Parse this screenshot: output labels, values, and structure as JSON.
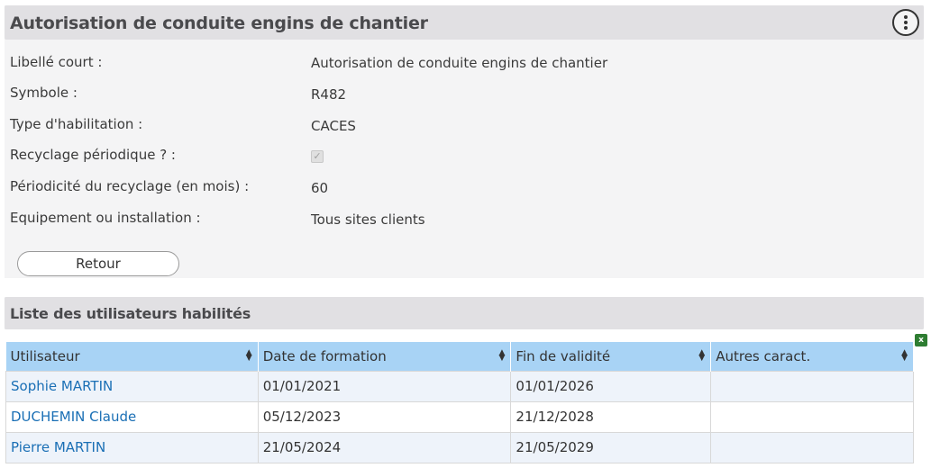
{
  "details": {
    "title": "Autorisation de conduite engins de chantier",
    "fields": [
      {
        "label": "Libellé court :",
        "value": "Autorisation de conduite engins de chantier"
      },
      {
        "label": "Symbole :",
        "value": "R482"
      },
      {
        "label": "Type d'habilitation :",
        "value": "CACES"
      },
      {
        "label": "Recyclage périodique ? :",
        "value": true
      },
      {
        "label": "Périodicité du recyclage (en mois) :",
        "value": "60"
      },
      {
        "label": "Equipement ou installation :",
        "value": "Tous sites clients"
      }
    ],
    "back_button": "Retour"
  },
  "users": {
    "title": "Liste des utilisateurs habilités",
    "columns": [
      "Utilisateur",
      "Date de formation",
      "Fin de validité",
      "Autres caract."
    ],
    "rows": [
      {
        "user": "Sophie MARTIN",
        "formation": "01/01/2021",
        "validity": "01/01/2026",
        "other": ""
      },
      {
        "user": "DUCHEMIN Claude",
        "formation": "05/12/2023",
        "validity": "21/12/2028",
        "other": ""
      },
      {
        "user": "Pierre MARTIN",
        "formation": "21/05/2024",
        "validity": "21/05/2029",
        "other": ""
      }
    ]
  }
}
